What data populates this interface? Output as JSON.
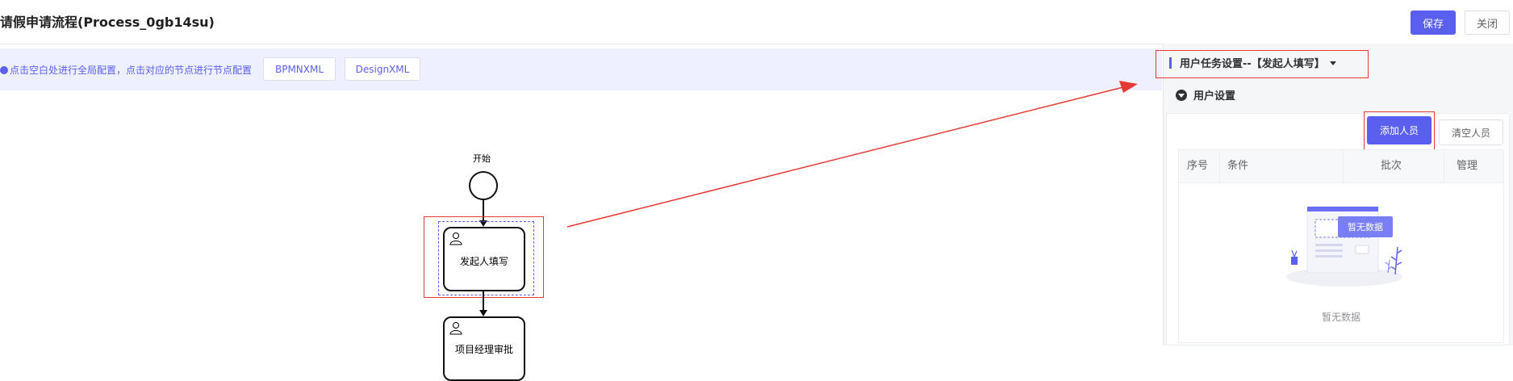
{
  "header": {
    "title": "请假申请流程(Process_0gb14su)",
    "save_label": "保存",
    "close_label": "关闭"
  },
  "hint_bar": {
    "text": "点击空白处进行全局配置，点击对应的节点进行节点配置",
    "bpmn_label": "BPMNXML",
    "design_label": "DesignXML"
  },
  "diagram": {
    "start_label": "开始",
    "task1_label": "发起人填写",
    "task2_label": "项目经理审批"
  },
  "panel": {
    "title": "用户任务设置--【发起人填写】",
    "section_title": "用户设置",
    "add_button": "添加人员",
    "clear_button": "清空人员",
    "table": {
      "columns": [
        "序号",
        "条件",
        "批次",
        "管理"
      ],
      "rows": [],
      "empty_badge": "暂无数据",
      "empty_text": "暂无数据"
    }
  },
  "colors": {
    "accent": "#5b5ff0",
    "annotation": "#e53935",
    "hint_bg": "#eef0ff"
  }
}
